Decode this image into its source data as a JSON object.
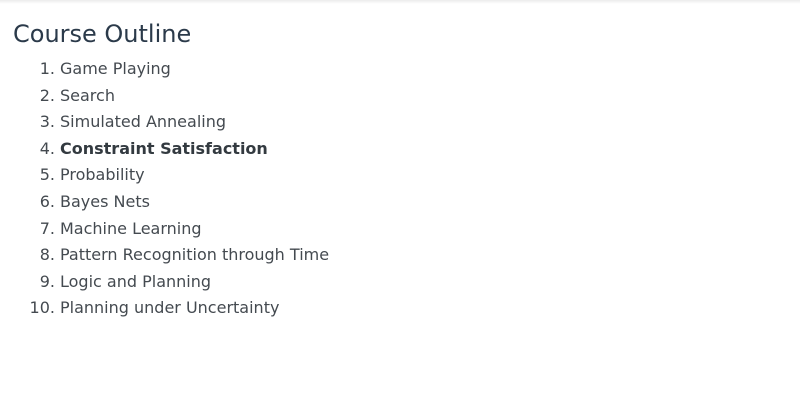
{
  "page": {
    "title": "Course Outline"
  },
  "outline": {
    "items": [
      {
        "number": "1.",
        "label": "Game Playing",
        "active": false
      },
      {
        "number": "2.",
        "label": "Search",
        "active": false
      },
      {
        "number": "3.",
        "label": "Simulated Annealing",
        "active": false
      },
      {
        "number": "4.",
        "label": "Constraint Satisfaction",
        "active": true
      },
      {
        "number": "5.",
        "label": "Probability",
        "active": false
      },
      {
        "number": "6.",
        "label": "Bayes Nets",
        "active": false
      },
      {
        "number": "7.",
        "label": "Machine Learning",
        "active": false
      },
      {
        "number": "8.",
        "label": "Pattern Recognition through Time",
        "active": false
      },
      {
        "number": "9.",
        "label": "Logic and Planning",
        "active": false
      },
      {
        "number": "10.",
        "label": "Planning under Uncertainty",
        "active": false
      }
    ]
  },
  "colors": {
    "title": "#2b3a4a",
    "text": "#444a50"
  }
}
